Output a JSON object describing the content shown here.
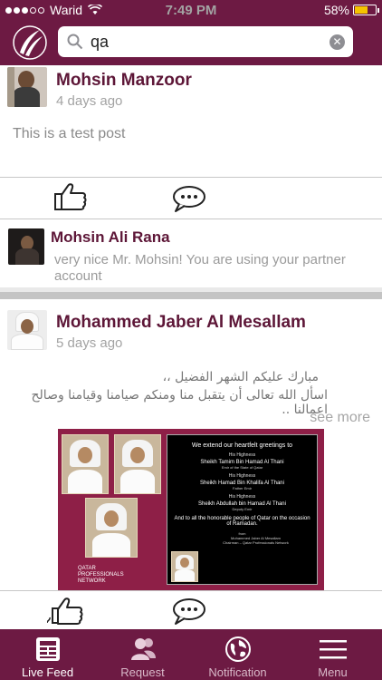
{
  "status_bar": {
    "carrier": "Warid",
    "time": "7:49 PM",
    "battery": "58%"
  },
  "search": {
    "value": "qa"
  },
  "posts": [
    {
      "author": "Mohsin Manzoor",
      "time": "4 days ago",
      "text": "This is a test post",
      "comment": {
        "author": "Mohsin Ali Rana",
        "text": "very nice Mr. Mohsin! You are using your partner account"
      }
    },
    {
      "author": "Mohammed Jaber Al Mesallam",
      "time": "5 days ago",
      "arabic_line1": "مبارك عليكم الشهر الفضيل ،،",
      "arabic_line2": "اسأل الله تعالى أن يتقبل منا ومنكم صيامنا وقيامنا وصالح اعمالنا ..",
      "see_more": "see more",
      "image": {
        "l1": "We extend our heartfelt greetings to",
        "hh1": "His Highness",
        "n1": "Sheikh Tamim Bin Hamad Al Thani",
        "t1": "Emir of the State of Qatar",
        "hh2": "His Highness",
        "n2": "Sheikh Hamad Bin Khalifa Al Thani",
        "t2": "Father Emir",
        "hh3": "His Highness",
        "n3": "Sheikh Abdullah bin Hamad Al Thani",
        "t3": "Deputy Emir",
        "closing": "And to all the honorable people of Qatar on the occasion of Ramadan.",
        "from": "from",
        "from_name": "Mohammed Jaber Al Mesallam",
        "from_title": "Chairman – Qatar Professionals Network",
        "brand": "QATAR PROFESSIONALS NETWORK"
      }
    }
  ],
  "tabs": [
    {
      "label": "Live Feed"
    },
    {
      "label": "Request"
    },
    {
      "label": "Notification"
    },
    {
      "label": "Menu"
    }
  ],
  "colors": {
    "brand": "#6d1a43",
    "name": "#5d1637"
  }
}
